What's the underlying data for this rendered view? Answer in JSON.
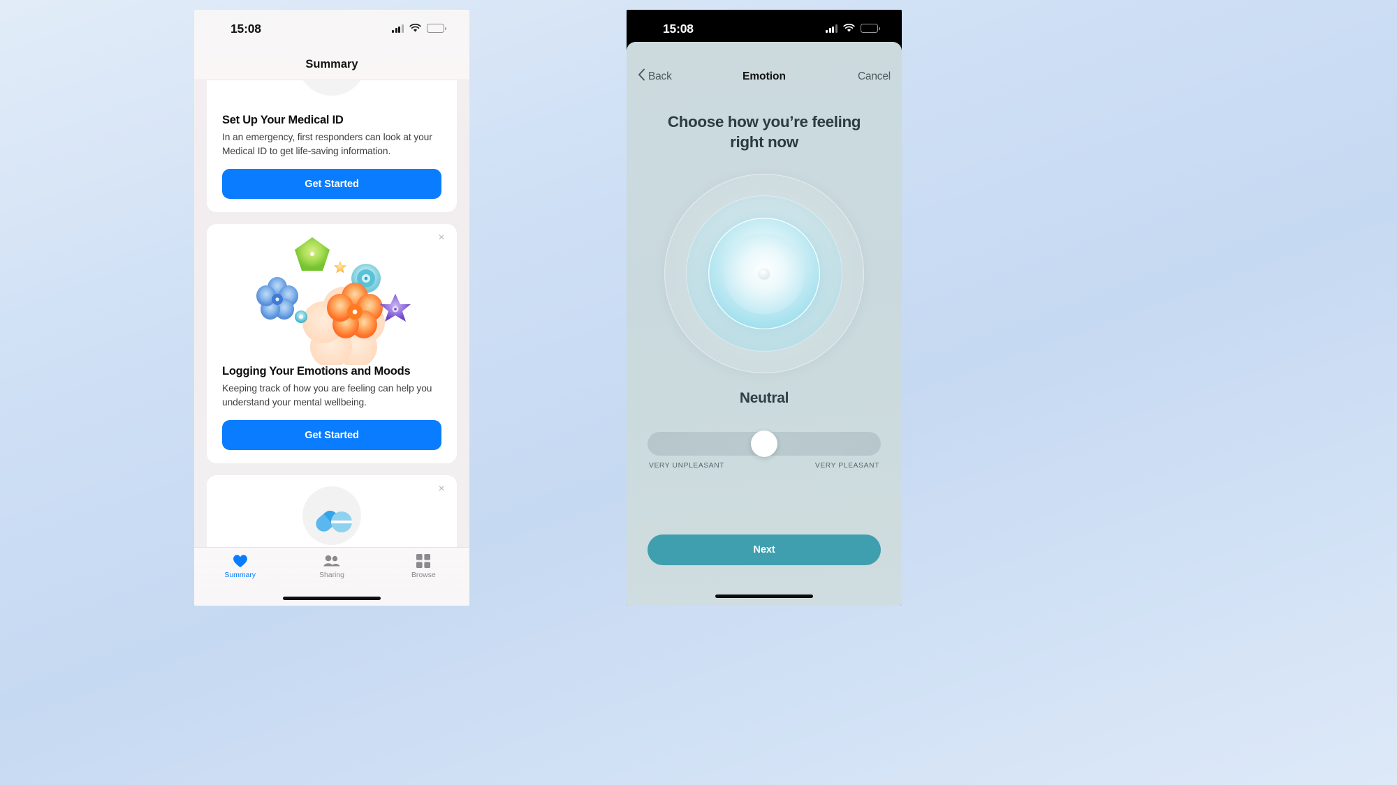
{
  "left_phone": {
    "status_bar": {
      "time": "15:08",
      "icons": [
        "signal-bars-icon",
        "wifi-icon",
        "battery-icon"
      ]
    },
    "nav": {
      "title": "Summary"
    },
    "cards": [
      {
        "id": "medical-id",
        "title": "Set Up Your Medical ID",
        "description": "In an emergency, first responders can look at your Medical ID to get life-saving information.",
        "button": "Get Started",
        "close": "×"
      },
      {
        "id": "emotions",
        "title": "Logging Your Emotions and Moods",
        "description": "Keeping track of how you are feeling can help you understand your mental wellbeing.",
        "button": "Get Started",
        "close": "×"
      },
      {
        "id": "medications",
        "title": "",
        "description": "",
        "button": "",
        "close": "×"
      }
    ],
    "tab_bar": [
      {
        "label": "Summary",
        "icon": "heart-icon",
        "active": true
      },
      {
        "label": "Sharing",
        "icon": "people-icon",
        "active": false
      },
      {
        "label": "Browse",
        "icon": "grid-icon",
        "active": false
      }
    ]
  },
  "right_phone": {
    "status_bar": {
      "time": "15:08",
      "icons": [
        "signal-bars-icon",
        "wifi-icon",
        "battery-icon"
      ]
    },
    "nav": {
      "back": "Back",
      "title": "Emotion",
      "cancel": "Cancel"
    },
    "headline": "Choose how you’re feeling right now",
    "mood_label": "Neutral",
    "slider": {
      "value_percent": 50,
      "left_label": "VERY UNPLEASANT",
      "right_label": "VERY PLEASANT"
    },
    "next_button": "Next"
  },
  "colors": {
    "ios_blue": "#0a7cff",
    "teal_button": "#3f9fae",
    "orb_cyan": "#7cd4e8",
    "sheet_bg": "#ccdade",
    "page_bg": "#cfe0f5"
  }
}
